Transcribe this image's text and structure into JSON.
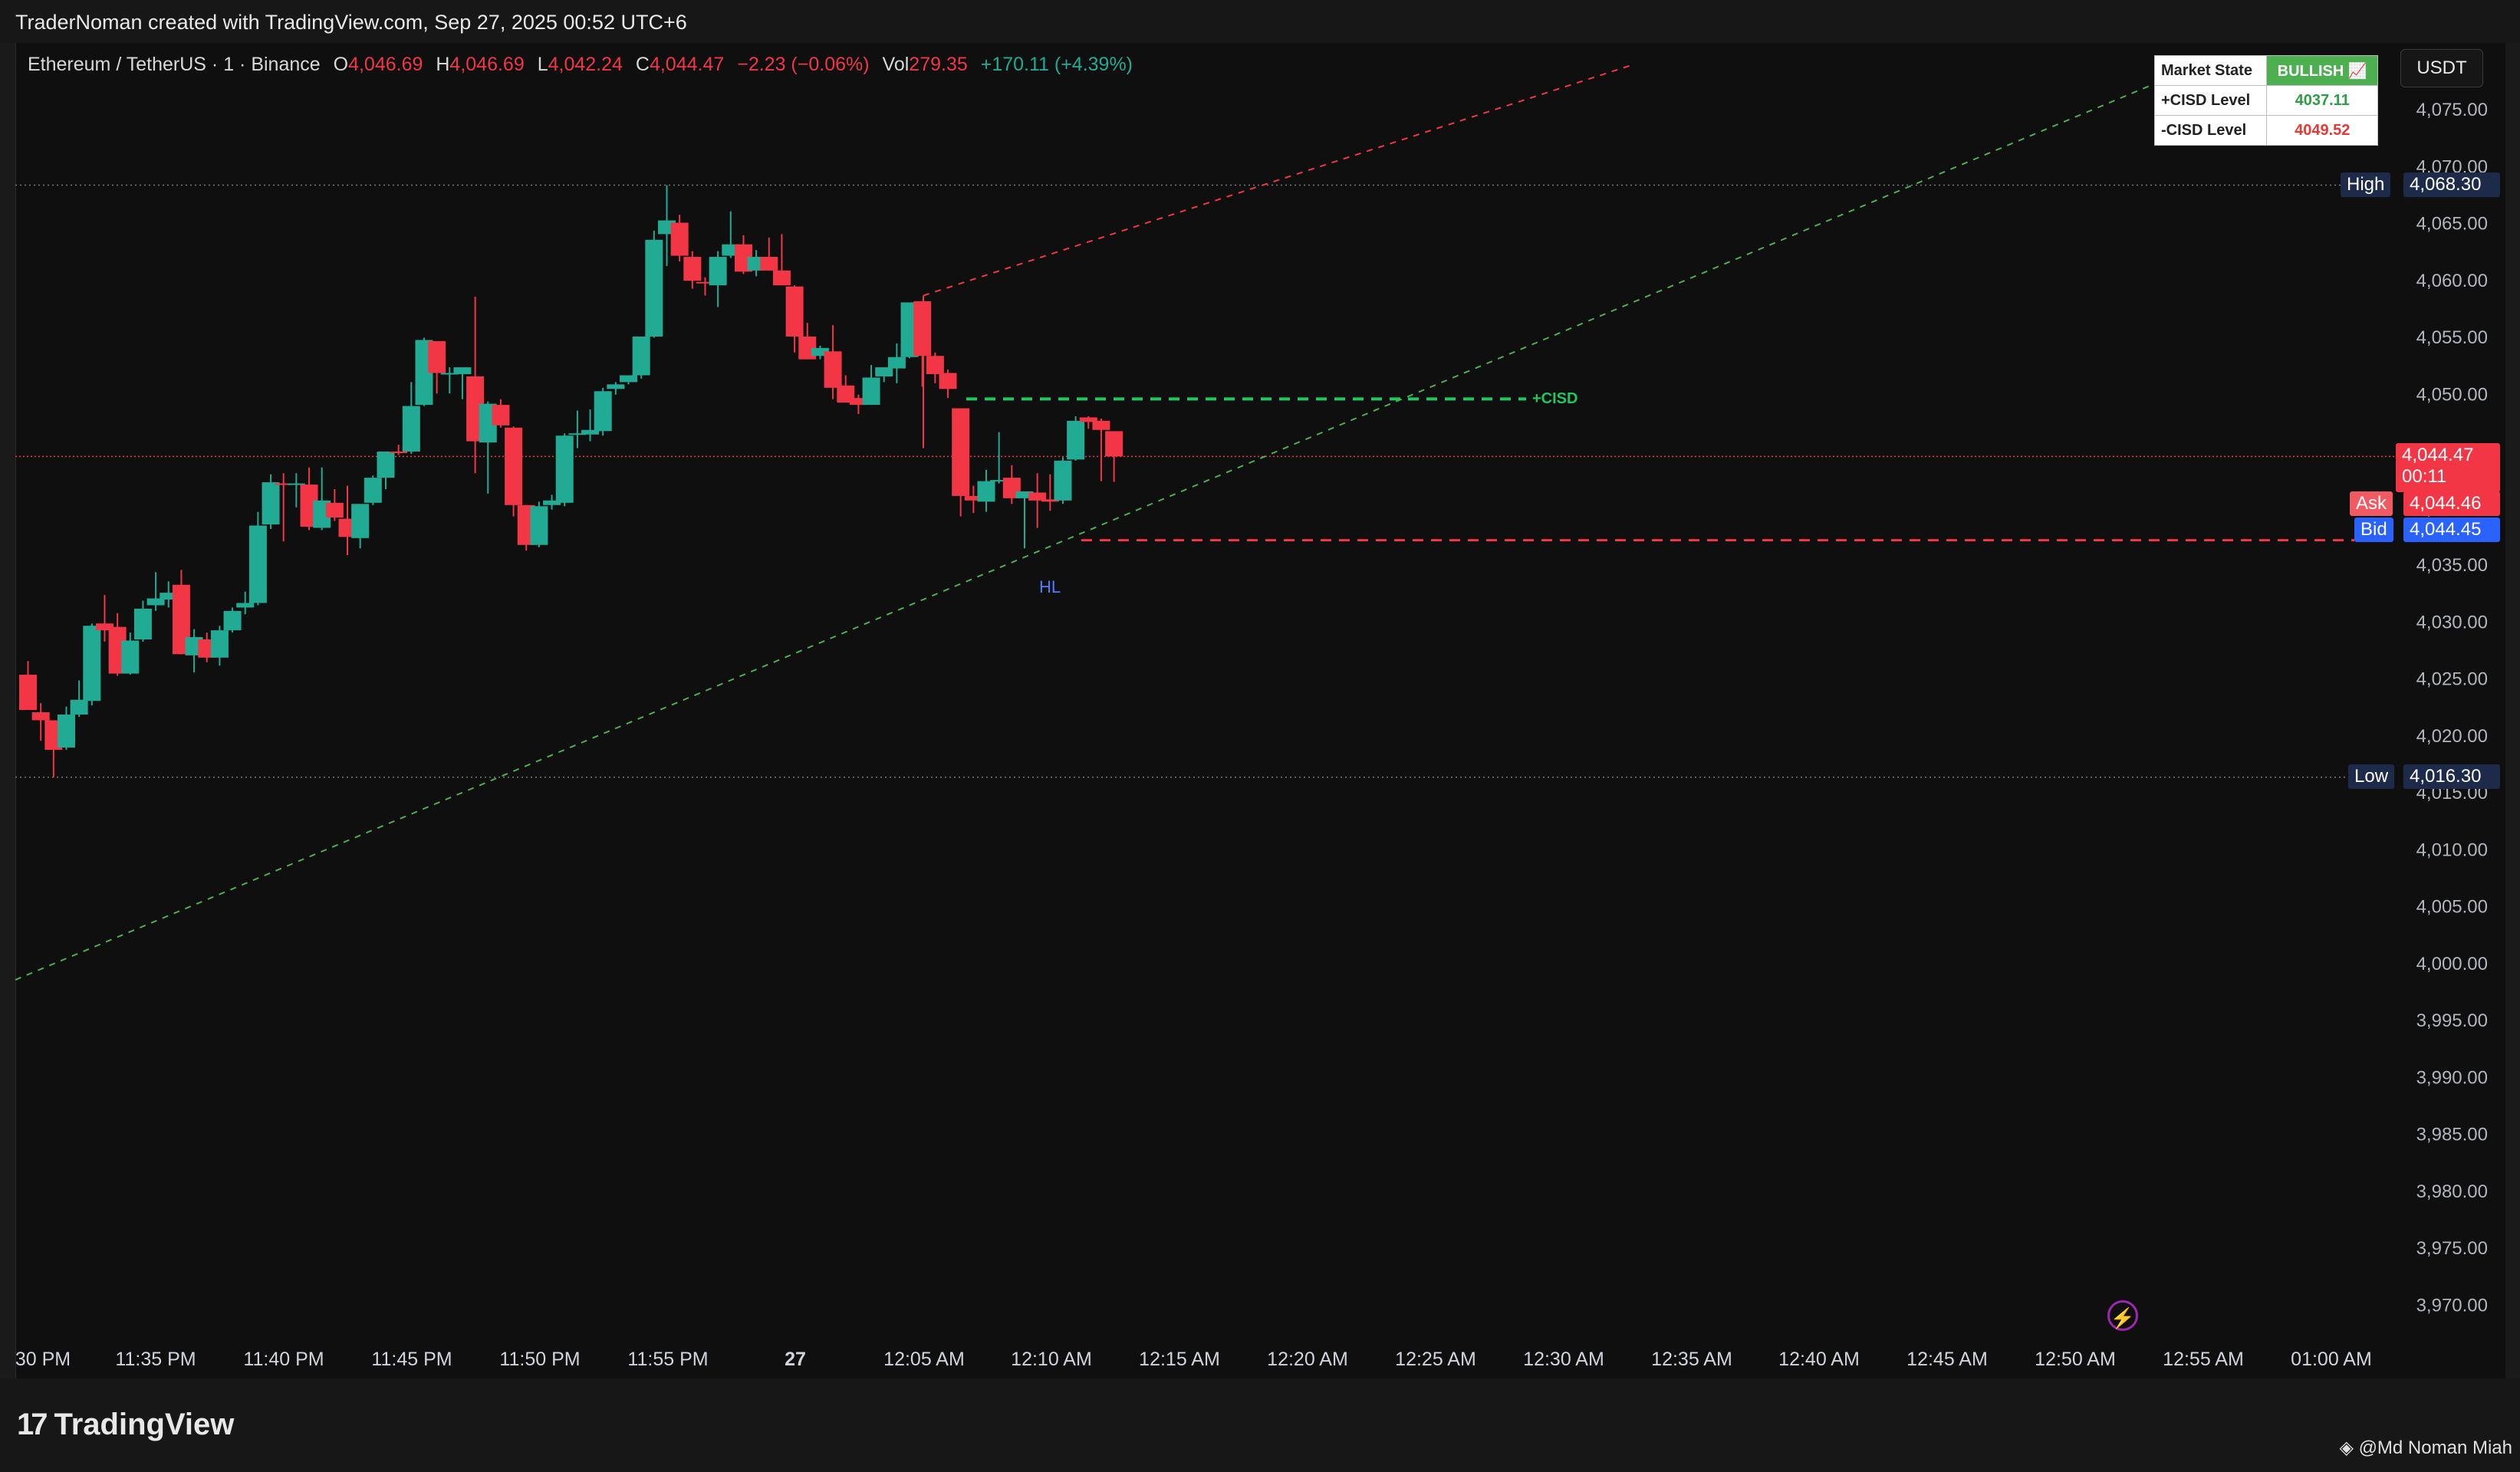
{
  "header": {
    "attribution": "TraderNoman created with TradingView.com, Sep 27, 2025 00:52 UTC+6"
  },
  "legend": {
    "symbol": "Ethereum / TetherUS · 1 · Binance",
    "o_label": "O",
    "o_value": "4,046.69",
    "h_label": "H",
    "h_value": "4,046.69",
    "l_label": "L",
    "l_value": "4,042.24",
    "c_label": "C",
    "c_value": "4,044.47",
    "change": "−2.23 (−0.06%)",
    "vol_label": "Vol",
    "vol_value": "279.35",
    "vol_change": "+170.11 (+4.39%)"
  },
  "currency_button": "USDT",
  "market_table": {
    "state_label": "Market State",
    "state_value": "BULLISH 📈",
    "plus_label": "+CISD Level",
    "plus_value": "4037.11",
    "minus_label": "-CISD Level",
    "minus_value": "4049.52"
  },
  "annotations": {
    "cisd": "+CISD",
    "hl": "HL"
  },
  "price_tags": {
    "high_label": "High",
    "high_value": "4,068.30",
    "low_label": "Low",
    "low_value": "4,016.30",
    "current_value": "4,044.47",
    "countdown": "00:11",
    "ask_label": "Ask",
    "ask_value": "4,044.46",
    "bid_label": "Bid",
    "bid_value": "4,044.45"
  },
  "footer": {
    "brand": "TradingView",
    "author": "@Md Noman Miah"
  },
  "colors": {
    "up": "#22ab94",
    "down": "#f23645",
    "bg": "#0f0f0f"
  },
  "chart_data": {
    "type": "candlestick",
    "symbol": "Ethereum / TetherUS",
    "interval": "1",
    "y_ticks": [
      4075,
      4070,
      4065,
      4060,
      4055,
      4050,
      4045,
      4040,
      4035,
      4030,
      4025,
      4020,
      4015,
      4010,
      4005,
      4000,
      3995,
      3990,
      3985,
      3980,
      3975,
      3970
    ],
    "y_tick_labels": [
      "4,075.00",
      "4,070.00",
      "4,065.00",
      "4,060.00",
      "4,055.00",
      "4,050.00",
      "4,045.00",
      "4,040.00",
      "4,035.00",
      "4,030.00",
      "4,025.00",
      "4,020.00",
      "4,015.00",
      "4,010.00",
      "4,005.00",
      "4,000.00",
      "3,995.00",
      "3,990.00",
      "3,985.00",
      "3,980.00",
      "3,975.00",
      "3,970.00"
    ],
    "x_tick_labels": [
      "30 PM",
      "11:35 PM",
      "11:40 PM",
      "11:45 PM",
      "11:50 PM",
      "11:55 PM",
      "27",
      "12:05 AM",
      "12:10 AM",
      "12:15 AM",
      "12:20 AM",
      "12:25 AM",
      "12:30 AM",
      "12:35 AM",
      "12:40 AM",
      "12:45 AM",
      "12:50 AM",
      "12:55 AM",
      "01:00 AM"
    ],
    "ylim": [
      3967,
      4080
    ],
    "candles": [
      [
        4025.3,
        4026.5,
        4022.2,
        4022.2
      ],
      [
        4022.0,
        4022.8,
        4019.5,
        4021.3
      ],
      [
        4021.3,
        4021.3,
        4016.3,
        4018.7
      ],
      [
        4018.9,
        4022.5,
        4018.7,
        4021.8
      ],
      [
        4021.8,
        4024.8,
        4021.6,
        4023.1
      ],
      [
        4023.0,
        4029.8,
        4022.6,
        4029.6
      ],
      [
        4029.8,
        4032.3,
        4028.2,
        4029.2
      ],
      [
        4029.5,
        4030.7,
        4025.2,
        4025.4
      ],
      [
        4025.4,
        4029.0,
        4025.3,
        4028.3
      ],
      [
        4028.4,
        4031.8,
        4028.2,
        4031.1
      ],
      [
        4031.4,
        4034.3,
        4030.9,
        4032.0
      ],
      [
        4031.9,
        4033.5,
        4031.2,
        4032.5
      ],
      [
        4033.2,
        4034.5,
        4027.1,
        4027.1
      ],
      [
        4027.0,
        4029.3,
        4025.5,
        4028.6
      ],
      [
        4028.4,
        4029.0,
        4026.4,
        4026.8
      ],
      [
        4026.8,
        4029.6,
        4026.1,
        4029.2
      ],
      [
        4029.2,
        4031.2,
        4029.0,
        4030.9
      ],
      [
        4031.2,
        4032.6,
        4030.6,
        4031.6
      ],
      [
        4031.6,
        4039.6,
        4031.4,
        4038.4
      ],
      [
        4038.5,
        4042.9,
        4038.1,
        4042.2
      ],
      [
        4042.1,
        4043.0,
        4037.0,
        4042.0
      ],
      [
        4042.0,
        4043.0,
        4040.0,
        4042.1
      ],
      [
        4042.0,
        4043.5,
        4038.0,
        4038.3
      ],
      [
        4038.2,
        4043.5,
        4038.0,
        4040.6
      ],
      [
        4040.4,
        4041.6,
        4038.8,
        4039.1
      ],
      [
        4039.0,
        4041.9,
        4035.8,
        4037.4
      ],
      [
        4037.3,
        4040.2,
        4036.4,
        4040.3
      ],
      [
        4040.4,
        4042.8,
        4040.2,
        4042.6
      ],
      [
        4042.6,
        4043.4,
        4041.6,
        4044.9
      ],
      [
        4044.9,
        4045.5,
        4044.6,
        4044.8
      ],
      [
        4044.9,
        4051.0,
        4044.7,
        4048.9
      ],
      [
        4049.0,
        4054.9,
        4048.9,
        4054.7
      ],
      [
        4054.6,
        4054.6,
        4050.0,
        4051.8
      ],
      [
        4051.8,
        4052.3,
        4050.0,
        4051.8
      ],
      [
        4051.7,
        4052.2,
        4049.5,
        4052.3
      ],
      [
        4051.5,
        4058.5,
        4043.0,
        4045.8
      ],
      [
        4045.7,
        4049.3,
        4041.2,
        4049.1
      ],
      [
        4049.0,
        4049.5,
        4047.0,
        4047.2
      ],
      [
        4047.0,
        4047.1,
        4039.2,
        4040.2
      ],
      [
        4040.2,
        4040.2,
        4036.2,
        4036.7
      ],
      [
        4036.7,
        4040.5,
        4036.5,
        4040.1
      ],
      [
        4040.2,
        4041.1,
        4039.8,
        4040.6
      ],
      [
        4040.4,
        4046.5,
        4040.1,
        4046.3
      ],
      [
        4046.4,
        4048.5,
        4045.2,
        4046.5
      ],
      [
        4046.4,
        4048.6,
        4045.8,
        4046.8
      ],
      [
        4046.7,
        4050.5,
        4046.3,
        4050.2
      ],
      [
        4050.4,
        4051.0,
        4049.9,
        4050.8
      ],
      [
        4051.0,
        4051.6,
        4050.8,
        4051.6
      ],
      [
        4051.6,
        4055.0,
        4051.3,
        4055.0
      ],
      [
        4055.0,
        4064.3,
        4054.9,
        4063.5
      ],
      [
        4064.0,
        4068.3,
        4061.2,
        4065.2
      ],
      [
        4065.0,
        4065.7,
        4061.6,
        4062.1
      ],
      [
        4062.0,
        4062.5,
        4059.2,
        4059.9
      ],
      [
        4059.8,
        4060.2,
        4058.6,
        4059.7
      ],
      [
        4059.5,
        4062.5,
        4057.6,
        4062.0
      ],
      [
        4062.1,
        4066.0,
        4061.9,
        4063.1
      ],
      [
        4063.1,
        4063.9,
        4060.5,
        4060.7
      ],
      [
        4060.8,
        4062.6,
        4060.3,
        4062.0
      ],
      [
        4062.0,
        4063.7,
        4060.8,
        4060.8
      ],
      [
        4060.8,
        4064.0,
        4059.5,
        4059.5
      ],
      [
        4059.4,
        4059.5,
        4053.6,
        4055.0
      ],
      [
        4055.0,
        4056.2,
        4053.0,
        4053.0
      ],
      [
        4053.3,
        4054.2,
        4053.0,
        4054.0
      ],
      [
        4053.7,
        4056.0,
        4049.5,
        4050.5
      ],
      [
        4050.7,
        4051.6,
        4049.6,
        4049.2
      ],
      [
        4049.6,
        4049.9,
        4048.2,
        4049.0
      ],
      [
        4049.0,
        4052.5,
        4049.0,
        4051.4
      ],
      [
        4051.5,
        4052.2,
        4051.0,
        4052.3
      ],
      [
        4052.2,
        4054.4,
        4050.9,
        4053.2
      ],
      [
        4053.2,
        4058.0,
        4053.1,
        4058.0
      ],
      [
        4058.1,
        4058.1,
        4050.6,
        4053.3
      ],
      [
        4053.3,
        4053.6,
        4050.9,
        4051.7
      ],
      [
        4051.8,
        4052.1,
        4049.6,
        4050.4
      ],
      [
        4048.7,
        4048.7,
        4039.2,
        4041.0
      ],
      [
        4041.0,
        4041.9,
        4039.5,
        4040.6
      ],
      [
        4040.5,
        4043.3,
        4039.6,
        4042.3
      ],
      [
        4042.3,
        4046.6,
        4042.1,
        4042.4
      ],
      [
        4042.6,
        4043.7,
        4040.3,
        4040.8
      ],
      [
        4040.8,
        4041.1,
        4036.4,
        4041.4
      ],
      [
        4041.3,
        4043.0,
        4038.2,
        4040.6
      ],
      [
        4040.7,
        4042.9,
        4039.7,
        4040.5
      ],
      [
        4040.6,
        4044.4,
        4040.3,
        4044.1
      ],
      [
        4044.2,
        4048.0,
        4044.1,
        4047.6
      ],
      [
        4047.9,
        4048.0,
        4046.9,
        4047.5
      ],
      [
        4047.6,
        4047.8,
        4042.3,
        4046.8
      ],
      [
        4046.69,
        4046.69,
        4042.24,
        4044.47
      ]
    ]
  }
}
